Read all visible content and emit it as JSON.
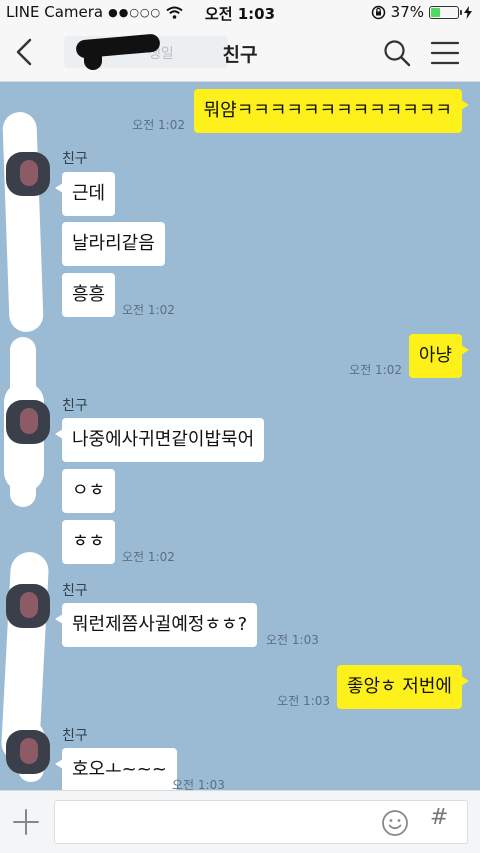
{
  "status_bar": {
    "carrier": "LINE Camera",
    "signal": "●●○○○",
    "time": "오전 1:03",
    "battery_pct": "37%",
    "battery_level": 0.37
  },
  "header": {
    "title": "친구",
    "ghost_text": "생일"
  },
  "messages": [
    {
      "side": "me",
      "text": "뭐얌ㅋㅋㅋㅋㅋㅋㅋㅋㅋㅋㅋㅋㅋ",
      "time": "오전 1:02"
    },
    {
      "side": "other",
      "sender": "친구",
      "texts": [
        "근데",
        "날라리같음",
        "흥흥"
      ],
      "time": "오전 1:02"
    },
    {
      "side": "me",
      "text": "아냥",
      "time": "오전 1:02"
    },
    {
      "side": "other",
      "sender": "친구",
      "texts": [
        "나중에사귀면같이밥묵어",
        "ㅇㅎ",
        "ㅎㅎ"
      ],
      "time": "오전 1:02"
    },
    {
      "side": "other",
      "sender": "친구",
      "texts": [
        "뭐런제쯤사귈예정ㅎㅎ?"
      ],
      "time": "오전 1:03"
    },
    {
      "side": "me",
      "text": "좋앙ㅎ 저번에",
      "time": "오전 1:03"
    },
    {
      "side": "other",
      "sender": "친구",
      "texts": [
        "호오ㅗ~~~"
      ],
      "time": "오전 1:03"
    }
  ],
  "input": {
    "value": "",
    "placeholder": ""
  },
  "icons": {
    "back": "chevron-left-icon",
    "search": "search-icon",
    "menu": "hamburger-menu-icon",
    "attach": "plus-icon",
    "emoji": "emoji-icon",
    "hash": "hash-icon",
    "wifi": "wifi-icon",
    "lock": "rotation-lock-icon",
    "charge": "bolt-icon"
  },
  "colors": {
    "chat_bg": "#9bbbd4",
    "my_bubble": "#fef01b",
    "their_bubble": "#ffffff"
  },
  "input_hash": "#"
}
